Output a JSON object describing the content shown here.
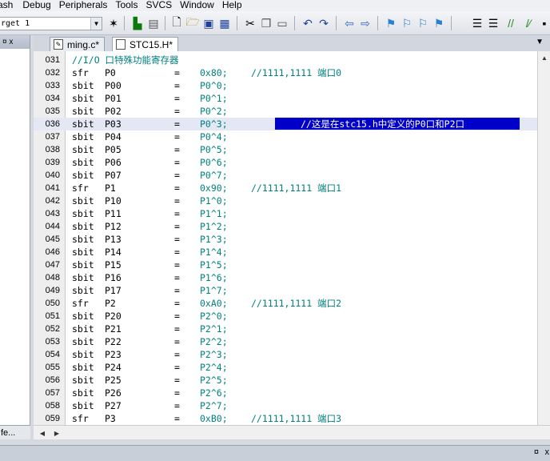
{
  "menu": [
    "ash",
    "Debug",
    "Peripherals",
    "Tools",
    "SVCS",
    "Window",
    "Help"
  ],
  "toolbar": {
    "target": "rget 1"
  },
  "left_panel": {
    "pin": "¤ x",
    "bottom_tab": "fe..."
  },
  "tabs": [
    {
      "label": "ming.c*",
      "active": false
    },
    {
      "label": "STC15.H*",
      "active": true
    }
  ],
  "code": {
    "header_line": {
      "num": "031",
      "text": "//I/O 口特殊功能寄存器"
    },
    "lines": [
      {
        "num": "032",
        "kw": "sfr",
        "name": "P0",
        "val": "0x80;",
        "comment": "//1111,1111 端口0"
      },
      {
        "num": "033",
        "kw": "sbit",
        "name": "P00",
        "val": "P0^0;"
      },
      {
        "num": "034",
        "kw": "sbit",
        "name": "P01",
        "val": "P0^1;"
      },
      {
        "num": "035",
        "kw": "sbit",
        "name": "P02",
        "val": "P0^2;"
      },
      {
        "num": "036",
        "kw": "sbit",
        "name": "P03",
        "val": "P0^3;",
        "selected_comment": "//这是在stc15.h中定义的P0口和P2口"
      },
      {
        "num": "037",
        "kw": "sbit",
        "name": "P04",
        "val": "P0^4;"
      },
      {
        "num": "038",
        "kw": "sbit",
        "name": "P05",
        "val": "P0^5;"
      },
      {
        "num": "039",
        "kw": "sbit",
        "name": "P06",
        "val": "P0^6;"
      },
      {
        "num": "040",
        "kw": "sbit",
        "name": "P07",
        "val": "P0^7;"
      },
      {
        "num": "041",
        "kw": "sfr",
        "name": "P1",
        "val": "0x90;",
        "comment": "//1111,1111 端口1"
      },
      {
        "num": "042",
        "kw": "sbit",
        "name": "P10",
        "val": "P1^0;"
      },
      {
        "num": "043",
        "kw": "sbit",
        "name": "P11",
        "val": "P1^1;"
      },
      {
        "num": "044",
        "kw": "sbit",
        "name": "P12",
        "val": "P1^2;"
      },
      {
        "num": "045",
        "kw": "sbit",
        "name": "P13",
        "val": "P1^3;"
      },
      {
        "num": "046",
        "kw": "sbit",
        "name": "P14",
        "val": "P1^4;"
      },
      {
        "num": "047",
        "kw": "sbit",
        "name": "P15",
        "val": "P1^5;"
      },
      {
        "num": "048",
        "kw": "sbit",
        "name": "P16",
        "val": "P1^6;"
      },
      {
        "num": "049",
        "kw": "sbit",
        "name": "P17",
        "val": "P1^7;"
      },
      {
        "num": "050",
        "kw": "sfr",
        "name": "P2",
        "val": "0xA0;",
        "comment": "//1111,1111 端口2"
      },
      {
        "num": "051",
        "kw": "sbit",
        "name": "P20",
        "val": "P2^0;"
      },
      {
        "num": "052",
        "kw": "sbit",
        "name": "P21",
        "val": "P2^1;"
      },
      {
        "num": "053",
        "kw": "sbit",
        "name": "P22",
        "val": "P2^2;"
      },
      {
        "num": "054",
        "kw": "sbit",
        "name": "P23",
        "val": "P2^3;"
      },
      {
        "num": "055",
        "kw": "sbit",
        "name": "P24",
        "val": "P2^4;"
      },
      {
        "num": "056",
        "kw": "sbit",
        "name": "P25",
        "val": "P2^5;"
      },
      {
        "num": "057",
        "kw": "sbit",
        "name": "P26",
        "val": "P2^6;"
      },
      {
        "num": "058",
        "kw": "sbit",
        "name": "P27",
        "val": "P2^7;"
      },
      {
        "num": "059",
        "kw": "sfr",
        "name": "P3",
        "val": "0xB0;",
        "comment": "//1111,1111 端口3"
      }
    ]
  },
  "bottom_bar": {
    "pin": "¤",
    "close": "x"
  }
}
